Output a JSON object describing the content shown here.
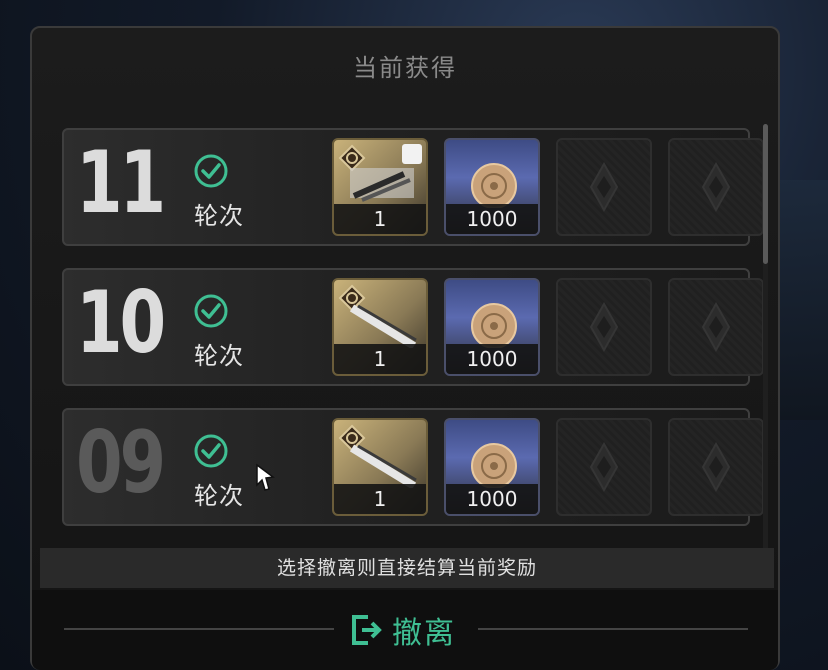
{
  "panel": {
    "title": "当前获得"
  },
  "rounds": [
    {
      "number": "11",
      "label": "轮次",
      "dim": false,
      "rewards": [
        {
          "kind": "item",
          "qty": "1",
          "tool": true
        },
        {
          "kind": "coin",
          "qty": "1000"
        },
        {
          "kind": "empty"
        },
        {
          "kind": "empty"
        }
      ]
    },
    {
      "number": "10",
      "label": "轮次",
      "dim": false,
      "rewards": [
        {
          "kind": "item",
          "qty": "1",
          "tool": false
        },
        {
          "kind": "coin",
          "qty": "1000"
        },
        {
          "kind": "empty"
        },
        {
          "kind": "empty"
        }
      ]
    },
    {
      "number": "09",
      "label": "轮次",
      "dim": true,
      "rewards": [
        {
          "kind": "item",
          "qty": "1",
          "tool": false
        },
        {
          "kind": "coin",
          "qty": "1000"
        },
        {
          "kind": "empty"
        },
        {
          "kind": "empty"
        }
      ]
    }
  ],
  "info": {
    "text": "选择撤离则直接结算当前奖励"
  },
  "footer": {
    "retreat_label": "撤离",
    "retreat_icon": "exit-icon"
  },
  "colors": {
    "accent": "#3fbf93",
    "text": "#e5e5e5",
    "muted": "#8a8a8a"
  }
}
